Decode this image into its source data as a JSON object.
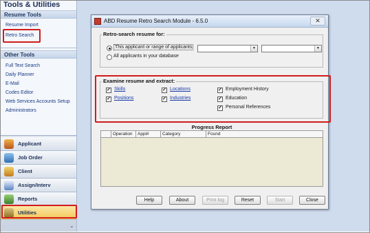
{
  "left_panel": {
    "title": "Tools & Utilities",
    "sections": [
      {
        "header": "Resume Tools",
        "items": [
          "Resume Import",
          "Retro Search"
        ]
      },
      {
        "header": "Other Tools",
        "items": [
          "Full Text Search",
          "Daily Planner",
          "E-Mail",
          "Codes Editor",
          "Web Services Accounts Setup",
          "Administrators"
        ]
      }
    ],
    "selected_tool": "Retro Search"
  },
  "navigation": {
    "items": [
      {
        "label": "Applicant",
        "icon": "people-icon"
      },
      {
        "label": "Job Order",
        "icon": "job-order-icon"
      },
      {
        "label": "Client",
        "icon": "client-icon"
      },
      {
        "label": "Assign/Interv",
        "icon": "calendar-icon"
      },
      {
        "label": "Reports",
        "icon": "reports-icon"
      },
      {
        "label": "Utilities",
        "icon": "utilities-icon"
      }
    ],
    "active": "Utilities"
  },
  "dialog": {
    "title": "ABD Resume Retro Search Module - 6.5.0",
    "close_glyph": "✕",
    "retro": {
      "label": "Retro-search resume for:",
      "options": [
        "This applicant or range of applicants",
        "All applicants in your database"
      ],
      "selected_index": 0,
      "combo_from": "",
      "combo_to": ""
    },
    "examine": {
      "label": "Examine resume and extract:",
      "col1": [
        "Skills",
        "Positions"
      ],
      "col2": [
        "Locations",
        "Industries"
      ],
      "col3": [
        "Employment History",
        "Education",
        "Personal References"
      ],
      "all_checked": true,
      "check_glyph": "✓"
    },
    "report": {
      "title": "Progress Report",
      "columns": [
        "",
        "Operation",
        "Appl#",
        "Category",
        "Found"
      ],
      "rows": []
    },
    "buttons": [
      {
        "label": "Help",
        "enabled": true
      },
      {
        "label": "About",
        "enabled": true
      },
      {
        "label": "Print log",
        "enabled": false
      },
      {
        "label": "Reset",
        "enabled": true
      },
      {
        "label": "Start",
        "enabled": false
      },
      {
        "label": "Close",
        "enabled": true
      }
    ]
  },
  "colors": {
    "highlight": "#d11b1b",
    "link": "#1a3a85",
    "nav_active": "#f4c657",
    "report_bg": "#ece9d4"
  }
}
